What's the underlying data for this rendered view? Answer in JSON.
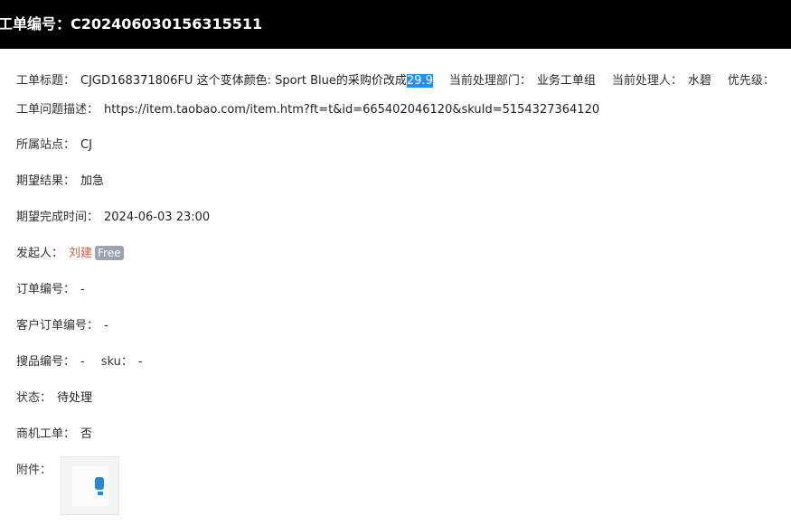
{
  "header": {
    "title": "工单编号：C202406030156315511"
  },
  "fields": {
    "title_label": "工单标题：",
    "title_value": "CJGD168371806FU 这个变体颜色: Sport Blue的采购价改成",
    "title_highlight": "29.9",
    "dept_label": "当前处理部门：",
    "dept_value": "业务工单组",
    "handler_label": "当前处理人：",
    "handler_value": "水碧",
    "priority_label": "优先级：",
    "desc_label": "工单问题描述：",
    "desc_value": "https://item.taobao.com/item.htm?ft=t&id=665402046120&skuId=5154327364120",
    "site_label": "所属站点：",
    "site_value": "CJ",
    "expect_label": "期望结果：",
    "expect_value": "加急",
    "deadline_label": "期望完成时间：",
    "deadline_value": "2024-06-03 23:00",
    "initiator_label": "发起人：",
    "initiator_value": "刘建",
    "initiator_badge": "Free",
    "order_label": "订单编号：",
    "order_value": "-",
    "cust_order_label": "客户订单编号：",
    "cust_order_value": "-",
    "search_label": "搜品编号：",
    "search_value": "-",
    "sku_label": "sku：",
    "sku_value": "-",
    "status_label": "状态：",
    "status_value": "待处理",
    "biz_label": "商机工单：",
    "biz_value": "否",
    "attach_label": "附件："
  },
  "colors": {
    "header_bg": "#000000",
    "highlight": "#1e90ff",
    "initiator": "#e2553a",
    "badge_bg": "#9aa3b2"
  }
}
